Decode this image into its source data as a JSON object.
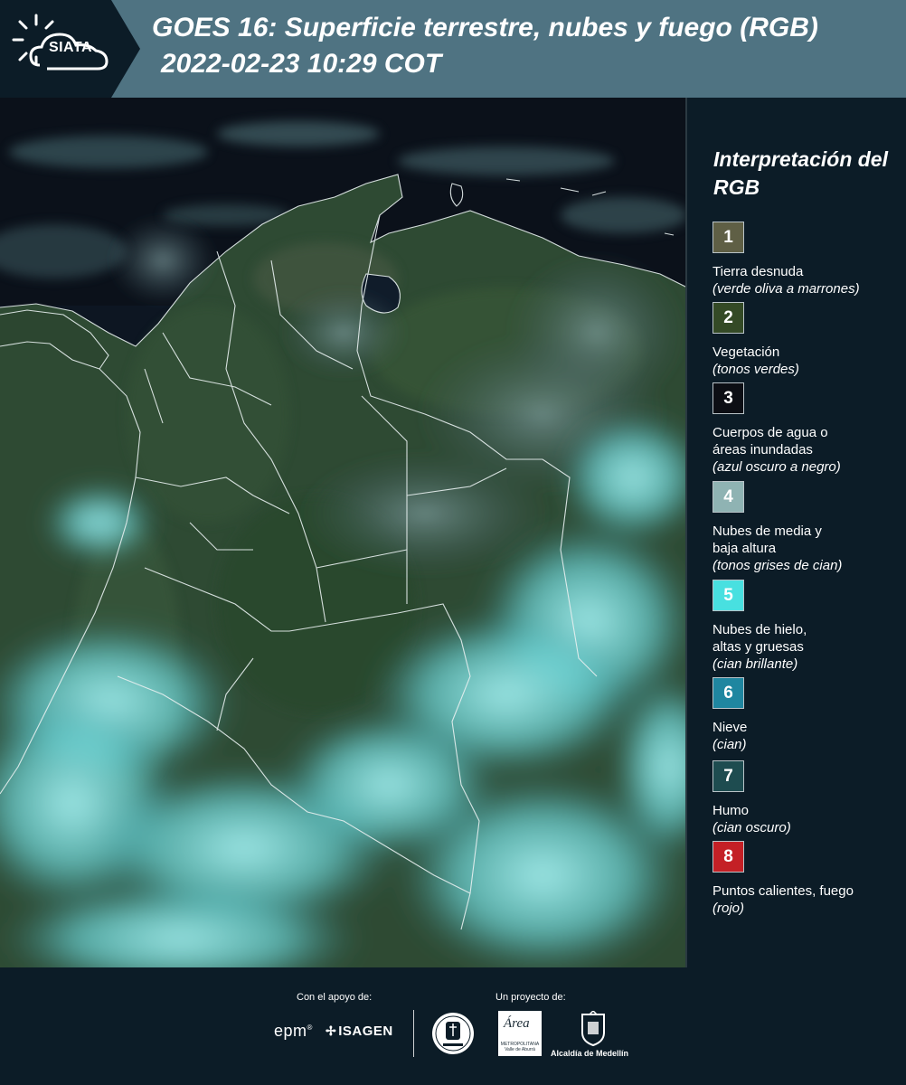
{
  "header": {
    "logo_text": "SIATA",
    "title_line1": "GOES 16: Superficie terrestre, nubes y fuego (RGB)",
    "title_line2": "2022-02-23 10:29 COT"
  },
  "legend": {
    "title": "Interpretación del RGB",
    "items": [
      {
        "number": "1",
        "label": "Tierra desnuda",
        "sub": "(verde oliva a marrones)",
        "color": "#5f5f45"
      },
      {
        "number": "2",
        "label": "Vegetación",
        "sub": "(tonos verdes)",
        "color": "#344a26"
      },
      {
        "number": "3",
        "label": "Cuerpos de agua o áreas inundadas",
        "sub": "(azul oscuro a negro)",
        "color": "#0c0e14"
      },
      {
        "number": "4",
        "label": "Nubes de media y baja altura",
        "sub": "(tonos grises de cian)",
        "color": "#8fb3b3"
      },
      {
        "number": "5",
        "label": "Nubes de hielo, altas y gruesas",
        "sub": "(cian brillante)",
        "color": "#48e0e0"
      },
      {
        "number": "6",
        "label": "Nieve",
        "sub": "(cian)",
        "color": "#1f86a0"
      },
      {
        "number": "7",
        "label": "Humo",
        "sub": "(cian oscuro)",
        "color": "#1e4c50"
      },
      {
        "number": "8",
        "label": "Puntos calientes, fuego",
        "sub": "(rojo)",
        "color": "#c42026"
      }
    ]
  },
  "footer": {
    "support_label": "Con el apoyo de:",
    "project_label": "Un proyecto de:",
    "epm": "epm",
    "isagen": "ISAGEN",
    "area_script": "Área",
    "area_sub": "METROPOLITANA Valle de Aburrá",
    "alcaldia": "Alcaldía de Medellín"
  },
  "colors": {
    "header_bg": "#4f7382",
    "panel_bg": "#0c1c27",
    "ocean": "#0c1520",
    "vegetation": "#2f4a32",
    "cloud": "#6fd8d8"
  }
}
